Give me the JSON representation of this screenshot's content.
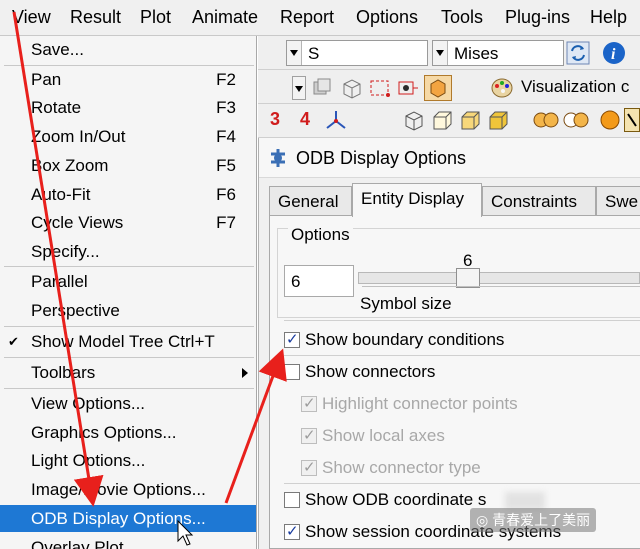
{
  "menubar": {
    "items": [
      "View",
      "Result",
      "Plot",
      "Animate",
      "Report",
      "Options",
      "Tools",
      "Plug-ins",
      "Help"
    ]
  },
  "view_menu": {
    "items": [
      {
        "label": "Save...",
        "shortcut": ""
      },
      {
        "label": "Pan",
        "shortcut": "F2"
      },
      {
        "label": "Rotate",
        "shortcut": "F3"
      },
      {
        "label": "Zoom In/Out",
        "shortcut": "F4"
      },
      {
        "label": "Box Zoom",
        "shortcut": "F5"
      },
      {
        "label": "Auto-Fit",
        "shortcut": "F6"
      },
      {
        "label": "Cycle Views",
        "shortcut": "F7"
      },
      {
        "label": "Specify...",
        "shortcut": ""
      },
      {
        "label": "Parallel",
        "shortcut": ""
      },
      {
        "label": "Perspective",
        "shortcut": ""
      },
      {
        "label": "Show Model Tree Ctrl+T",
        "shortcut": "",
        "checked": true
      },
      {
        "label": "Toolbars",
        "shortcut": "",
        "submenu": true
      },
      {
        "label": "View Options...",
        "shortcut": ""
      },
      {
        "label": "Graphics Options...",
        "shortcut": ""
      },
      {
        "label": "Light Options...",
        "shortcut": ""
      },
      {
        "label": "Image/Movie Options...",
        "shortcut": ""
      },
      {
        "label": "ODB Display Options...",
        "shortcut": "",
        "selected": true
      },
      {
        "label": "Overlay Plot",
        "shortcut": ""
      }
    ]
  },
  "toolbar": {
    "variable_combo": "S",
    "invariant_combo": "Mises",
    "visualization_label": "Visualization c",
    "num3": "3",
    "num4": "4"
  },
  "dialog": {
    "title": "ODB Display Options",
    "tabs": [
      "General",
      "Entity Display",
      "Constraints",
      "Swe"
    ],
    "active_tab": "Entity Display",
    "group_label": "Options",
    "symbol_size_value": "6",
    "slider_value": "6",
    "symbol_size_label": "Symbol size",
    "checkboxes": [
      {
        "label": "Show boundary conditions",
        "checked": true,
        "enabled": true
      },
      {
        "label": "Show connectors",
        "checked": false,
        "enabled": true
      },
      {
        "label": "Highlight connector points",
        "checked": true,
        "enabled": false
      },
      {
        "label": "Show local axes",
        "checked": true,
        "enabled": false
      },
      {
        "label": "Show connector type",
        "checked": true,
        "enabled": false
      },
      {
        "label": "Show ODB coordinate s",
        "checked": false,
        "enabled": true
      },
      {
        "label": "Show session coordinate systems",
        "checked": true,
        "enabled": true
      }
    ]
  },
  "watermark": "青春爱上了美丽",
  "colors": {
    "selection": "#1e78d4",
    "arrow": "#e8201c",
    "disabled_text": "#a8a8a8"
  }
}
